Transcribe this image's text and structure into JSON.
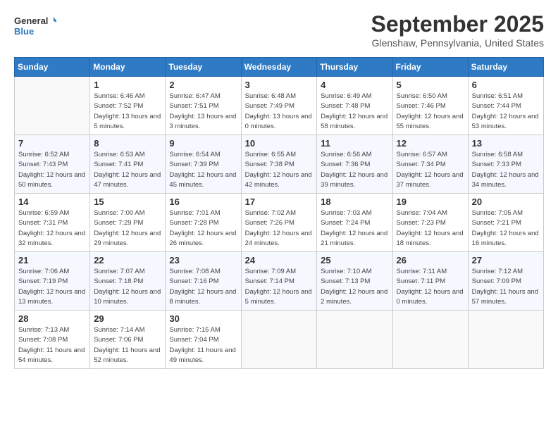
{
  "logo": {
    "line1": "General",
    "line2": "Blue"
  },
  "title": "September 2025",
  "location": "Glenshaw, Pennsylvania, United States",
  "days_header": [
    "Sunday",
    "Monday",
    "Tuesday",
    "Wednesday",
    "Thursday",
    "Friday",
    "Saturday"
  ],
  "weeks": [
    [
      {
        "num": "",
        "sunrise": "",
        "sunset": "",
        "daylight": ""
      },
      {
        "num": "1",
        "sunrise": "Sunrise: 6:46 AM",
        "sunset": "Sunset: 7:52 PM",
        "daylight": "Daylight: 13 hours and 5 minutes."
      },
      {
        "num": "2",
        "sunrise": "Sunrise: 6:47 AM",
        "sunset": "Sunset: 7:51 PM",
        "daylight": "Daylight: 13 hours and 3 minutes."
      },
      {
        "num": "3",
        "sunrise": "Sunrise: 6:48 AM",
        "sunset": "Sunset: 7:49 PM",
        "daylight": "Daylight: 13 hours and 0 minutes."
      },
      {
        "num": "4",
        "sunrise": "Sunrise: 6:49 AM",
        "sunset": "Sunset: 7:48 PM",
        "daylight": "Daylight: 12 hours and 58 minutes."
      },
      {
        "num": "5",
        "sunrise": "Sunrise: 6:50 AM",
        "sunset": "Sunset: 7:46 PM",
        "daylight": "Daylight: 12 hours and 55 minutes."
      },
      {
        "num": "6",
        "sunrise": "Sunrise: 6:51 AM",
        "sunset": "Sunset: 7:44 PM",
        "daylight": "Daylight: 12 hours and 53 minutes."
      }
    ],
    [
      {
        "num": "7",
        "sunrise": "Sunrise: 6:52 AM",
        "sunset": "Sunset: 7:43 PM",
        "daylight": "Daylight: 12 hours and 50 minutes."
      },
      {
        "num": "8",
        "sunrise": "Sunrise: 6:53 AM",
        "sunset": "Sunset: 7:41 PM",
        "daylight": "Daylight: 12 hours and 47 minutes."
      },
      {
        "num": "9",
        "sunrise": "Sunrise: 6:54 AM",
        "sunset": "Sunset: 7:39 PM",
        "daylight": "Daylight: 12 hours and 45 minutes."
      },
      {
        "num": "10",
        "sunrise": "Sunrise: 6:55 AM",
        "sunset": "Sunset: 7:38 PM",
        "daylight": "Daylight: 12 hours and 42 minutes."
      },
      {
        "num": "11",
        "sunrise": "Sunrise: 6:56 AM",
        "sunset": "Sunset: 7:36 PM",
        "daylight": "Daylight: 12 hours and 39 minutes."
      },
      {
        "num": "12",
        "sunrise": "Sunrise: 6:57 AM",
        "sunset": "Sunset: 7:34 PM",
        "daylight": "Daylight: 12 hours and 37 minutes."
      },
      {
        "num": "13",
        "sunrise": "Sunrise: 6:58 AM",
        "sunset": "Sunset: 7:33 PM",
        "daylight": "Daylight: 12 hours and 34 minutes."
      }
    ],
    [
      {
        "num": "14",
        "sunrise": "Sunrise: 6:59 AM",
        "sunset": "Sunset: 7:31 PM",
        "daylight": "Daylight: 12 hours and 32 minutes."
      },
      {
        "num": "15",
        "sunrise": "Sunrise: 7:00 AM",
        "sunset": "Sunset: 7:29 PM",
        "daylight": "Daylight: 12 hours and 29 minutes."
      },
      {
        "num": "16",
        "sunrise": "Sunrise: 7:01 AM",
        "sunset": "Sunset: 7:28 PM",
        "daylight": "Daylight: 12 hours and 26 minutes."
      },
      {
        "num": "17",
        "sunrise": "Sunrise: 7:02 AM",
        "sunset": "Sunset: 7:26 PM",
        "daylight": "Daylight: 12 hours and 24 minutes."
      },
      {
        "num": "18",
        "sunrise": "Sunrise: 7:03 AM",
        "sunset": "Sunset: 7:24 PM",
        "daylight": "Daylight: 12 hours and 21 minutes."
      },
      {
        "num": "19",
        "sunrise": "Sunrise: 7:04 AM",
        "sunset": "Sunset: 7:23 PM",
        "daylight": "Daylight: 12 hours and 18 minutes."
      },
      {
        "num": "20",
        "sunrise": "Sunrise: 7:05 AM",
        "sunset": "Sunset: 7:21 PM",
        "daylight": "Daylight: 12 hours and 16 minutes."
      }
    ],
    [
      {
        "num": "21",
        "sunrise": "Sunrise: 7:06 AM",
        "sunset": "Sunset: 7:19 PM",
        "daylight": "Daylight: 12 hours and 13 minutes."
      },
      {
        "num": "22",
        "sunrise": "Sunrise: 7:07 AM",
        "sunset": "Sunset: 7:18 PM",
        "daylight": "Daylight: 12 hours and 10 minutes."
      },
      {
        "num": "23",
        "sunrise": "Sunrise: 7:08 AM",
        "sunset": "Sunset: 7:16 PM",
        "daylight": "Daylight: 12 hours and 8 minutes."
      },
      {
        "num": "24",
        "sunrise": "Sunrise: 7:09 AM",
        "sunset": "Sunset: 7:14 PM",
        "daylight": "Daylight: 12 hours and 5 minutes."
      },
      {
        "num": "25",
        "sunrise": "Sunrise: 7:10 AM",
        "sunset": "Sunset: 7:13 PM",
        "daylight": "Daylight: 12 hours and 2 minutes."
      },
      {
        "num": "26",
        "sunrise": "Sunrise: 7:11 AM",
        "sunset": "Sunset: 7:11 PM",
        "daylight": "Daylight: 12 hours and 0 minutes."
      },
      {
        "num": "27",
        "sunrise": "Sunrise: 7:12 AM",
        "sunset": "Sunset: 7:09 PM",
        "daylight": "Daylight: 11 hours and 57 minutes."
      }
    ],
    [
      {
        "num": "28",
        "sunrise": "Sunrise: 7:13 AM",
        "sunset": "Sunset: 7:08 PM",
        "daylight": "Daylight: 11 hours and 54 minutes."
      },
      {
        "num": "29",
        "sunrise": "Sunrise: 7:14 AM",
        "sunset": "Sunset: 7:06 PM",
        "daylight": "Daylight: 11 hours and 52 minutes."
      },
      {
        "num": "30",
        "sunrise": "Sunrise: 7:15 AM",
        "sunset": "Sunset: 7:04 PM",
        "daylight": "Daylight: 11 hours and 49 minutes."
      },
      {
        "num": "",
        "sunrise": "",
        "sunset": "",
        "daylight": ""
      },
      {
        "num": "",
        "sunrise": "",
        "sunset": "",
        "daylight": ""
      },
      {
        "num": "",
        "sunrise": "",
        "sunset": "",
        "daylight": ""
      },
      {
        "num": "",
        "sunrise": "",
        "sunset": "",
        "daylight": ""
      }
    ]
  ]
}
